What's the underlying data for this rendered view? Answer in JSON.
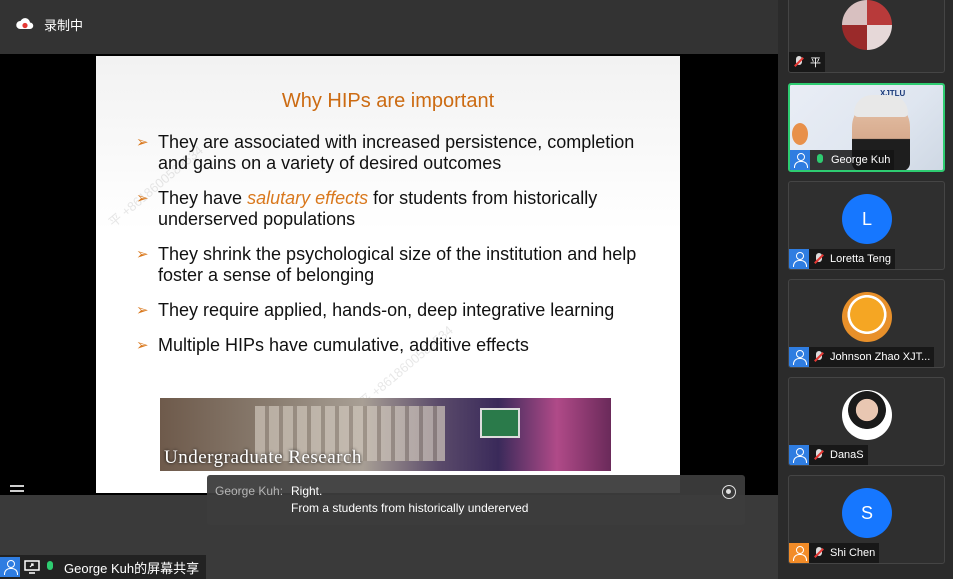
{
  "top": {
    "recording_label": "录制中"
  },
  "slide": {
    "title": "Why HIPs are important",
    "bullets": [
      {
        "pre": "They are associated with increased persistence, completion and gains on a variety of desired outcomes",
        "em": "",
        "post": ""
      },
      {
        "pre": "They have ",
        "em": "salutary effects",
        "post": " for students from historically underserved populations"
      },
      {
        "pre": "They shrink the psychological size of the institution and help foster a sense of belonging",
        "em": "",
        "post": ""
      },
      {
        "pre": "They require applied, hands-on, deep integrative learning",
        "em": "",
        "post": ""
      },
      {
        "pre": "Multiple HIPs have cumulative, additive effects",
        "em": "",
        "post": ""
      }
    ],
    "banner_text": "Undergraduate Research"
  },
  "caption": {
    "speaker": "George Kuh:",
    "line1": "Right.",
    "line2": "From a students from historically undererved"
  },
  "share": {
    "label": "George Kuh的屏幕共享"
  },
  "participants": [
    {
      "name": "平",
      "avatar": "",
      "avatar_type": "image",
      "mic": "muted",
      "icon": "none",
      "active": false
    },
    {
      "name": "George Kuh",
      "avatar": "",
      "avatar_type": "video",
      "mic": "on",
      "icon": "user",
      "active": true
    },
    {
      "name": "Loretta Teng",
      "avatar": "L",
      "avatar_type": "letter",
      "mic": "muted",
      "icon": "user",
      "active": false
    },
    {
      "name": "Johnson Zhao XJT...",
      "avatar": "",
      "avatar_type": "image",
      "mic": "muted",
      "icon": "user",
      "active": false
    },
    {
      "name": "DanaS",
      "avatar": "",
      "avatar_type": "image",
      "mic": "muted",
      "icon": "user",
      "active": false
    },
    {
      "name": "Shi Chen",
      "avatar": "S",
      "avatar_type": "letter",
      "mic": "muted",
      "icon": "user-orange",
      "active": false
    }
  ],
  "colors": {
    "accent_green": "#2ecc71",
    "avatar_blue": "#1677ff",
    "slide_orange": "#cc6b12"
  }
}
